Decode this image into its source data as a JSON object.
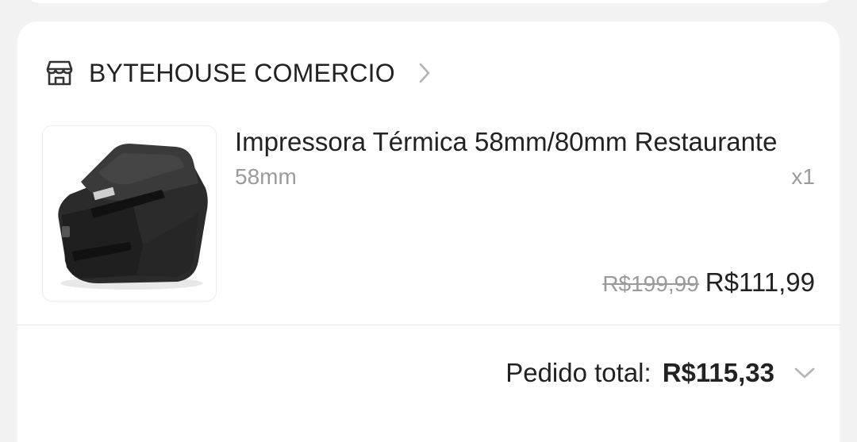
{
  "shop": {
    "icon": "store-icon",
    "name": "BYTEHOUSE COMERCIO",
    "chevron_icon": "chevron-right-icon"
  },
  "product": {
    "image_icon": "thermal-printer-image",
    "title": "Impressora Térmica 58mm/80mm Restaurante",
    "variant": "58mm",
    "quantity": "x1",
    "original_price": "R$199,99",
    "price": "R$111,99"
  },
  "order_total": {
    "label": "Pedido total:",
    "value": "R$115,33",
    "chevron_icon": "chevron-down-icon"
  },
  "colors": {
    "background": "#f2f2f2",
    "card": "#ffffff",
    "text": "#222222",
    "muted": "#9b9b9b"
  }
}
